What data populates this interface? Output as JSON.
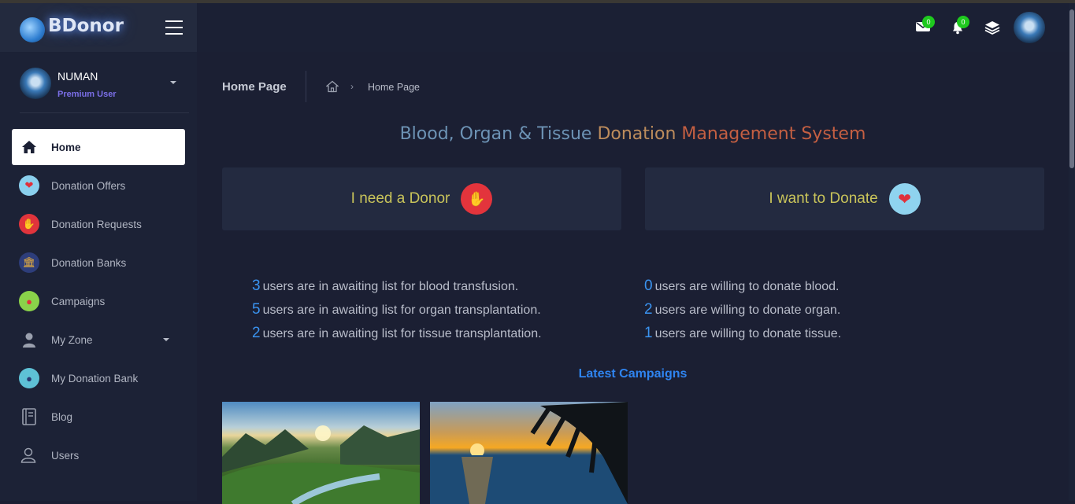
{
  "brand": {
    "name": "BDonor"
  },
  "header": {
    "mail_count": "0",
    "notif_count": "0"
  },
  "user": {
    "name": "NUMAN",
    "role": "Premium User"
  },
  "sidebar": {
    "items": [
      {
        "label": "Home",
        "icon": "home-icon"
      },
      {
        "label": "Donation Offers",
        "icon": "heart-offer-icon"
      },
      {
        "label": "Donation Requests",
        "icon": "hand-request-icon"
      },
      {
        "label": "Donation Banks",
        "icon": "bank-icon"
      },
      {
        "label": "Campaigns",
        "icon": "campaign-icon"
      },
      {
        "label": "My Zone",
        "icon": "user-icon"
      },
      {
        "label": "My Donation Bank",
        "icon": "donation-bank-icon"
      },
      {
        "label": "Blog",
        "icon": "blog-icon"
      },
      {
        "label": "Users",
        "icon": "users-icon"
      }
    ]
  },
  "breadcrumb": {
    "title": "Home Page",
    "current": "Home Page"
  },
  "headline": {
    "part1": "Blood, Organ & Tissue",
    "part2": "Donation",
    "part3": "Management System"
  },
  "cards": {
    "need": "I need a Donor",
    "donate": "I want to Donate"
  },
  "stats": {
    "awaiting": [
      {
        "num": "3",
        "text": "users are in awaiting list for blood transfusion."
      },
      {
        "num": "5",
        "text": "users are in awaiting list for organ transplantation."
      },
      {
        "num": "2",
        "text": "users are in awaiting list for tissue transplantation."
      }
    ],
    "willing": [
      {
        "num": "0",
        "text": "users are willing to donate blood."
      },
      {
        "num": "2",
        "text": "users are willing to donate organ."
      },
      {
        "num": "1",
        "text": "users are willing to donate tissue."
      }
    ]
  },
  "campaigns": {
    "title": "Latest Campaigns"
  },
  "colors": {
    "accent": "#3a93f0",
    "badge": "#1ec91e",
    "role": "#7b6fe8"
  }
}
